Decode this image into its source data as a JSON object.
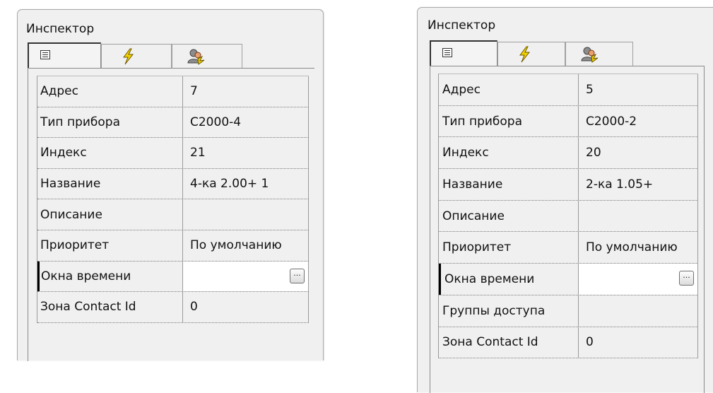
{
  "panels": [
    {
      "title": "Инспектор",
      "tabs": [
        {
          "icon": "property-list-icon"
        },
        {
          "icon": "lightning-icon"
        },
        {
          "icon": "users-icon"
        }
      ],
      "rows": [
        {
          "name": "Адрес",
          "value": "7"
        },
        {
          "name": "Тип прибора",
          "value": "С2000-4"
        },
        {
          "name": "Индекс",
          "value": "21"
        },
        {
          "name": "Название",
          "value": "4-ка 2.00+ 1"
        },
        {
          "name": "Описание",
          "value": ""
        },
        {
          "name": "Приоритет",
          "value": "По умолчанию"
        },
        {
          "name": "Окна времени",
          "value": "",
          "selected": true,
          "button": "..."
        },
        {
          "name": "Зона Contact Id",
          "value": "0"
        }
      ]
    },
    {
      "title": "Инспектор",
      "tabs": [
        {
          "icon": "property-list-icon"
        },
        {
          "icon": "lightning-icon"
        },
        {
          "icon": "users-icon"
        }
      ],
      "rows": [
        {
          "name": "Адрес",
          "value": "5"
        },
        {
          "name": "Тип прибора",
          "value": "С2000-2"
        },
        {
          "name": "Индекс",
          "value": "20"
        },
        {
          "name": "Название",
          "value": "2-ка 1.05+"
        },
        {
          "name": "Описание",
          "value": ""
        },
        {
          "name": "Приоритет",
          "value": "По умолчанию"
        },
        {
          "name": "Окна времени",
          "value": "",
          "selected": true,
          "button": "..."
        },
        {
          "name": "Группы доступа",
          "value": ""
        },
        {
          "name": "Зона Contact Id",
          "value": "0"
        }
      ]
    }
  ]
}
